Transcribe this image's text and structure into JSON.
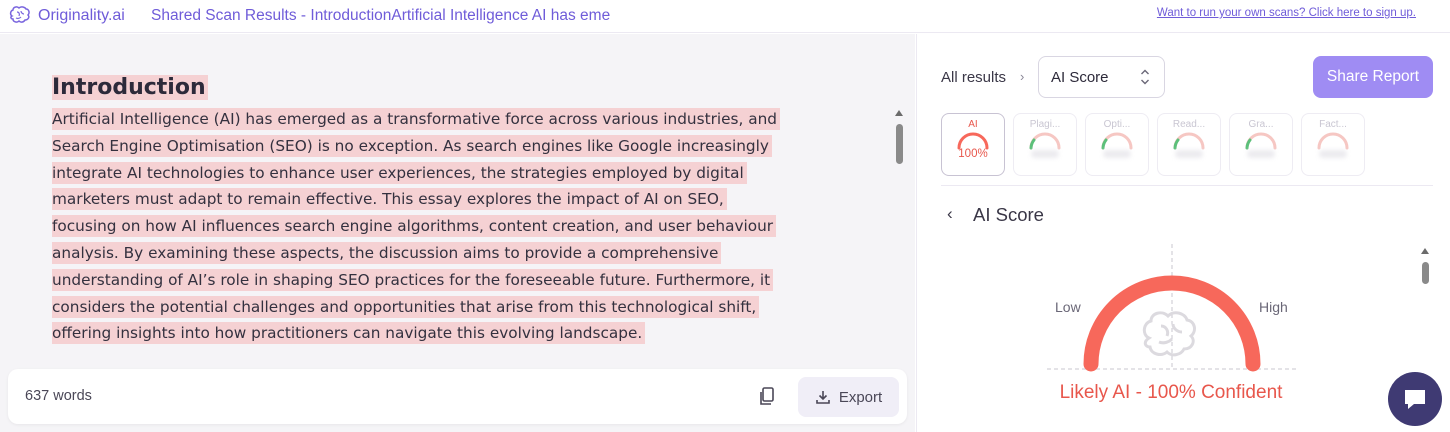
{
  "topbar": {
    "logo_text": "Originality.ai",
    "scan_title": "Shared Scan Results - IntroductionArtificial Intelligence AI has eme",
    "signup_link": "Want to run your own scans? Click here to sign up."
  },
  "document": {
    "heading": "Introduction",
    "lines": [
      "Artificial Intelligence (AI) has emerged as a transformative force across various industries, and",
      "Search Engine Optimisation (SEO) is no exception. As search engines like Google increasingly",
      "integrate AI technologies to enhance user experiences, the strategies employed by digital",
      "marketers must adapt to remain effective. This essay explores the impact of AI on SEO,",
      "focusing on how AI influences search engine algorithms, content creation, and user behaviour",
      "analysis. By examining these aspects, the discussion aims to provide a comprehensive",
      "understanding of AI’s role in shaping SEO practices for the foreseeable future. Furthermore, it",
      "considers the potential challenges and opportunities that arise from this technological shift,",
      "offering insights into how practitioners can navigate this evolving landscape."
    ],
    "highlight_color": "#f5d1d3"
  },
  "footer": {
    "word_count": "637 words",
    "export_label": "Export"
  },
  "panel": {
    "breadcrumb": "All results",
    "select_value": "AI Score",
    "share_label": "Share Report",
    "tabs": [
      {
        "label": "AI",
        "value": "100%"
      },
      {
        "label": "Plagi..."
      },
      {
        "label": "Opti..."
      },
      {
        "label": "Read..."
      },
      {
        "label": "Gra..."
      },
      {
        "label": "Fact..."
      }
    ],
    "score_title": "AI Score",
    "gauge_low": "Low",
    "gauge_high": "High",
    "result_text": "Likely AI - 100% Confident",
    "ai_score_percent": 100,
    "accent_color": "#e8574c",
    "gauge_color": "#f7685b"
  },
  "colors": {
    "brand": "#6f5cd9",
    "share_button": "#9f8cf3",
    "chat_button": "#3f3a73"
  }
}
